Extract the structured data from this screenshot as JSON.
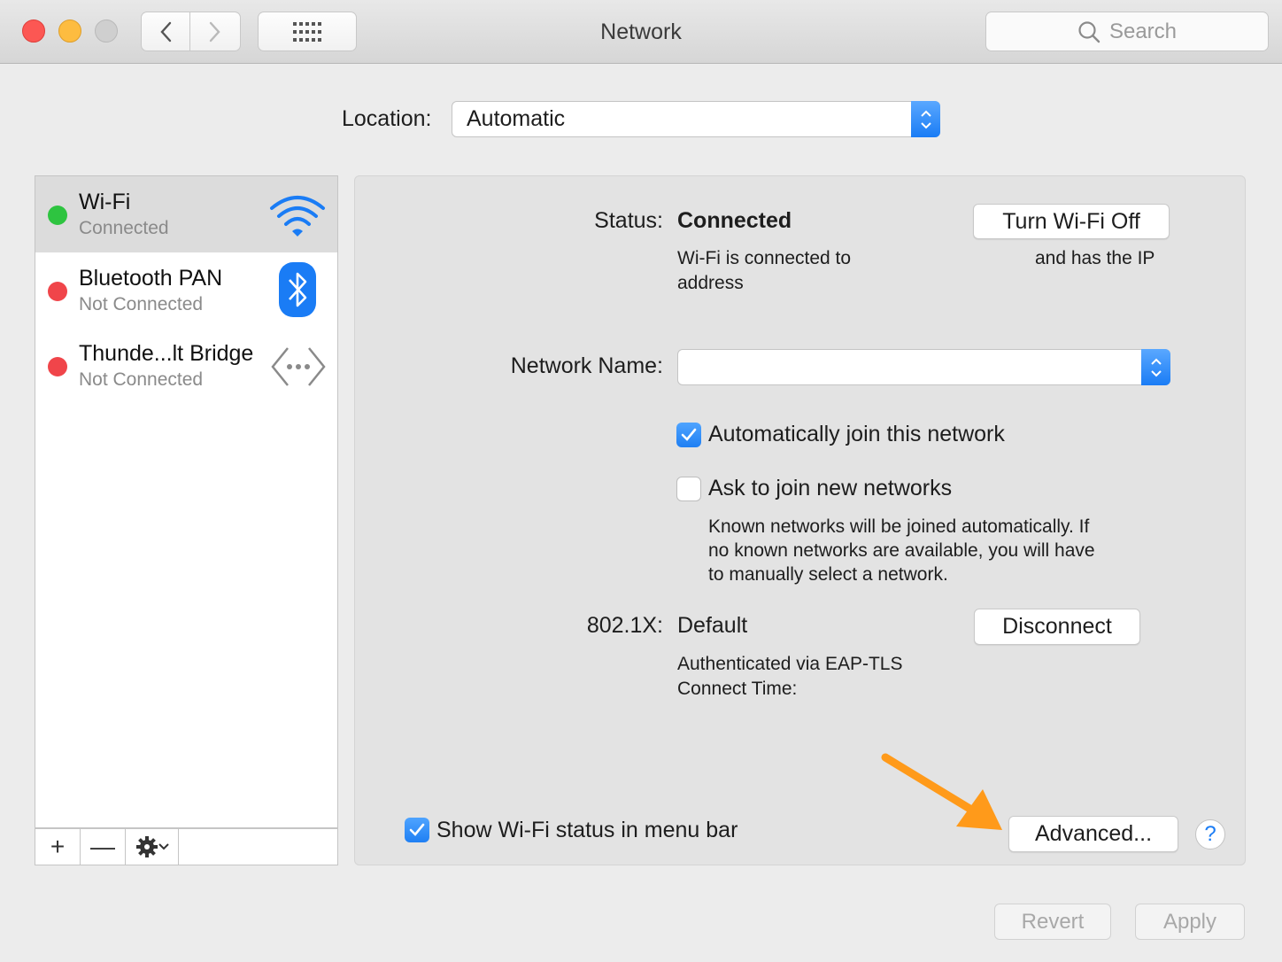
{
  "window": {
    "title": "Network"
  },
  "search": {
    "placeholder": "Search"
  },
  "location": {
    "label": "Location:",
    "value": "Automatic"
  },
  "services": [
    {
      "name": "Wi-Fi",
      "status": "Connected",
      "icon": "wifi-icon",
      "indicator": "green"
    },
    {
      "name": "Bluetooth PAN",
      "status": "Not Connected",
      "icon": "bluetooth-icon",
      "indicator": "red"
    },
    {
      "name": "Thunde...lt Bridge",
      "status": "Not Connected",
      "icon": "thunderbolt-bridge-icon",
      "indicator": "red"
    }
  ],
  "sidebar_controls": {
    "add": "+",
    "remove": "—"
  },
  "detail": {
    "status_label": "Status:",
    "status_value": "Connected",
    "toggle_button": "Turn Wi-Fi Off",
    "status_desc_left": "Wi-Fi is connected to",
    "status_desc_right": "and has the IP",
    "status_desc_line2": "address",
    "network_name_label": "Network Name:",
    "network_name_value": "",
    "auto_join": {
      "label": "Automatically join this network",
      "checked": true
    },
    "ask_join": {
      "label": "Ask to join new networks",
      "checked": false
    },
    "ask_join_help": [
      "Known networks will be joined automatically. If",
      "no known networks are available, you will have",
      "to manually select a network."
    ],
    "dot1x_label": "802.1X:",
    "dot1x_value": "Default",
    "disconnect_button": "Disconnect",
    "auth_desc": "Authenticated via EAP-TLS",
    "connect_time": "Connect Time:",
    "show_status": {
      "label": "Show Wi-Fi status in menu bar",
      "checked": true
    },
    "advanced_button": "Advanced...",
    "help": "?"
  },
  "footer": {
    "revert": "Revert",
    "apply": "Apply"
  },
  "colors": {
    "accent": "#1a7cf5",
    "connected": "#2ec440",
    "disconnected": "#f0454a",
    "highlight_arrow": "#ff9a1a"
  }
}
